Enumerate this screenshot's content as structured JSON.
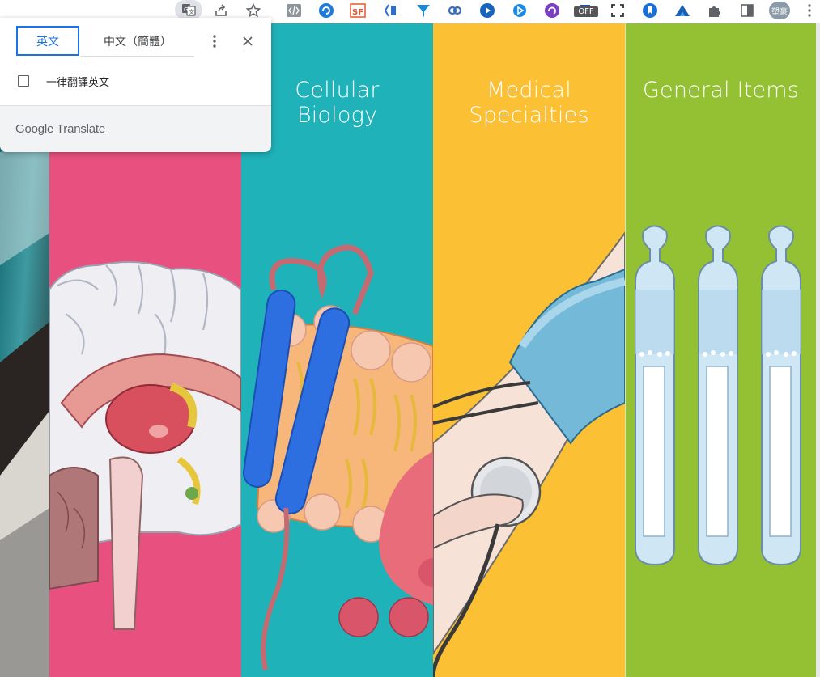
{
  "translate_popup": {
    "source_language": "英文",
    "target_language": "中文（簡體）",
    "always_translate_label": "一律翻譯英文",
    "brand": "Google Translate"
  },
  "toolbar": {
    "off_badge": "OFF",
    "profile_label": "塑豪"
  },
  "panels": [
    {
      "title_line1": "Cellular",
      "title_line2": "Biology",
      "color": "#1FB2B9"
    },
    {
      "title_line1": "Medical",
      "title_line2": "Specialties",
      "color": "#FBC034"
    },
    {
      "title_line1": "General Items",
      "title_line2": "",
      "color": "#93C133"
    }
  ],
  "colors": {
    "neuro_panel": "#E8517F",
    "photo_panel": "#0F6B72",
    "accent_blue": "#1a73e8"
  },
  "icons": [
    "translate-icon",
    "share-icon",
    "star-icon",
    "code-icon",
    "extension-icons",
    "puzzle-icon",
    "sidepanel-icon",
    "more-icon"
  ]
}
